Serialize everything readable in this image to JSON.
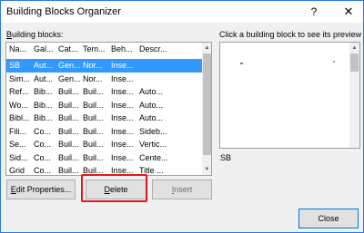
{
  "window": {
    "title": "Building Blocks Organizer",
    "help_label": "?",
    "close_label": "✕"
  },
  "list_label_key": "B",
  "list_label_rest": "uilding blocks:",
  "preview_label": "Click a building block to see its preview",
  "preview_name": "SB",
  "columns": [
    "Na...",
    "Gal...",
    "Cat...",
    "Tem...",
    "Beh...",
    "Descr..."
  ],
  "rows": [
    [
      "SB",
      "Aut...",
      "Gen...",
      "Nor...",
      "Inse...",
      ""
    ],
    [
      "Sim...",
      "Aut...",
      "Gen...",
      "Nor...",
      "Inse...",
      ""
    ],
    [
      "Ref...",
      "Bib...",
      "Buil...",
      "Buil...",
      "Inse...",
      "Auto..."
    ],
    [
      "Wo...",
      "Bib...",
      "Buil...",
      "Buil...",
      "Inse...",
      "Auto..."
    ],
    [
      "Bibl...",
      "Bib...",
      "Buil...",
      "Buil...",
      "Inse...",
      "Auto..."
    ],
    [
      "Fili...",
      "Co...",
      "Buil...",
      "Buil...",
      "Inse...",
      "Sideb..."
    ],
    [
      "Se...",
      "Co...",
      "Buil...",
      "Buil...",
      "Inse...",
      "Vertic..."
    ],
    [
      "Sid...",
      "Co...",
      "Buil...",
      "Buil...",
      "Inse...",
      "Cente..."
    ],
    [
      "Grid",
      "Co...",
      "Buil...",
      "Buil...",
      "Inse...",
      "Title ..."
    ]
  ],
  "buttons": {
    "edit_key": "E",
    "edit_rest": "dit Properties...",
    "delete_key": "D",
    "delete_rest": "elete",
    "insert_key": "I",
    "insert_rest": "nsert",
    "close": "Close"
  },
  "colors": {
    "selection": "#3399ff",
    "highlight": "#e0181b",
    "accent": "#0078d7"
  }
}
